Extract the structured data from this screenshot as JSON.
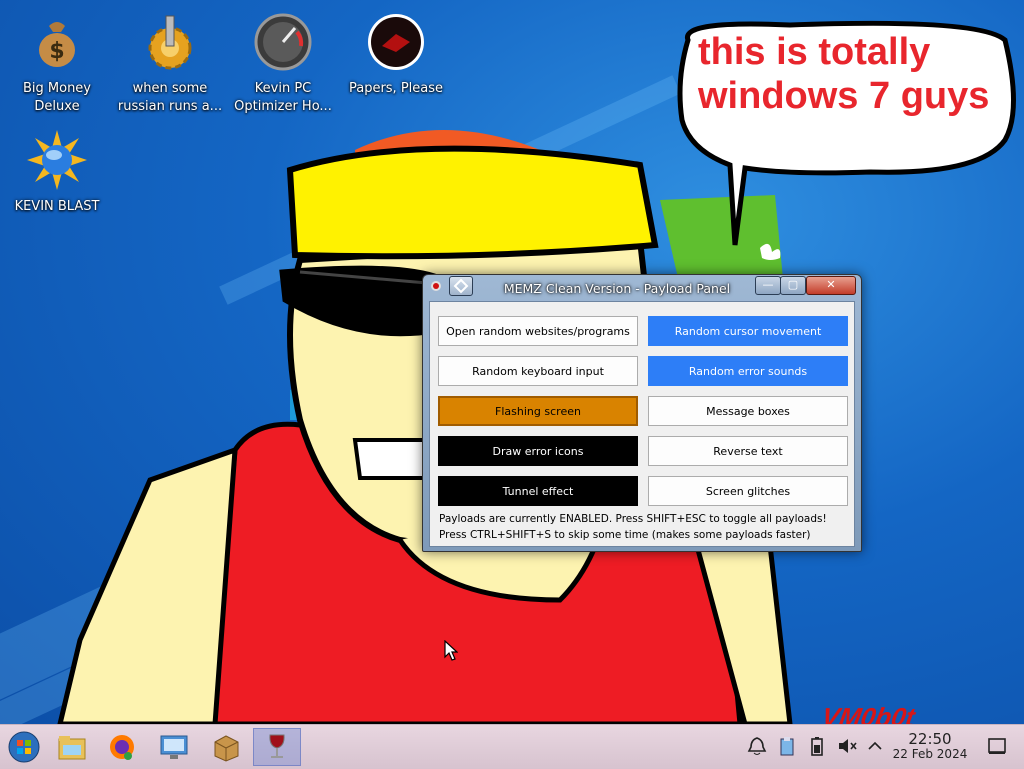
{
  "desktop": {
    "icons": [
      {
        "label_line1": "Big Money",
        "label_line2": "Deluxe",
        "icon": "money-bag-icon"
      },
      {
        "label_line1": "when some",
        "label_line2": "russian runs a...",
        "icon": "gear-icon"
      },
      {
        "label_line1": "Kevin PC",
        "label_line2": "Optimizer Ho...",
        "icon": "speedometer-icon"
      },
      {
        "label_line1": "Papers, Please",
        "label_line2": "",
        "icon": "papers-please-icon"
      },
      {
        "label_line1": "KEVIN BLAST",
        "label_line2": "",
        "icon": "sun-globe-icon"
      }
    ],
    "bubble_text": "this is totally windows 7 guys",
    "watermark": "VM0b0t"
  },
  "window": {
    "title": "MEMZ Clean Version - Payload Panel",
    "buttons": [
      {
        "label": "Open random websites/programs",
        "state": "off"
      },
      {
        "label": "Random cursor movement",
        "state": "on"
      },
      {
        "label": "Random keyboard input",
        "state": "off"
      },
      {
        "label": "Random error sounds",
        "state": "on"
      },
      {
        "label": "Flashing screen",
        "state": "flash"
      },
      {
        "label": "Message boxes",
        "state": "off"
      },
      {
        "label": "Draw error icons",
        "state": "dark"
      },
      {
        "label": "Reverse text",
        "state": "off"
      },
      {
        "label": "Tunnel effect",
        "state": "dark"
      },
      {
        "label": "Screen glitches",
        "state": "off"
      }
    ],
    "status_line1": "Payloads are currently ENABLED. Press SHIFT+ESC to toggle all payloads!",
    "status_line2": "Press CTRL+SHIFT+S to skip some time (makes some payloads faster)",
    "controls": {
      "minimize": "—",
      "maximize": "▢",
      "close": "✕"
    }
  },
  "taskbar": {
    "apps": [
      "start-orb-icon",
      "file-manager-icon",
      "firefox-icon",
      "control-panel-icon",
      "package-icon",
      "wine-icon"
    ],
    "tray": [
      "notification-bell-icon",
      "clipboard-icon",
      "battery-icon",
      "volume-muted-icon",
      "chevron-up-icon"
    ],
    "clock_time": "22:50",
    "clock_date": "22 Feb 2024"
  },
  "colors": {
    "accent_blue": "#2d7ef7",
    "flash_orange": "#d98300",
    "close_red": "#c33d2a",
    "bubble_red": "#e8262d"
  }
}
